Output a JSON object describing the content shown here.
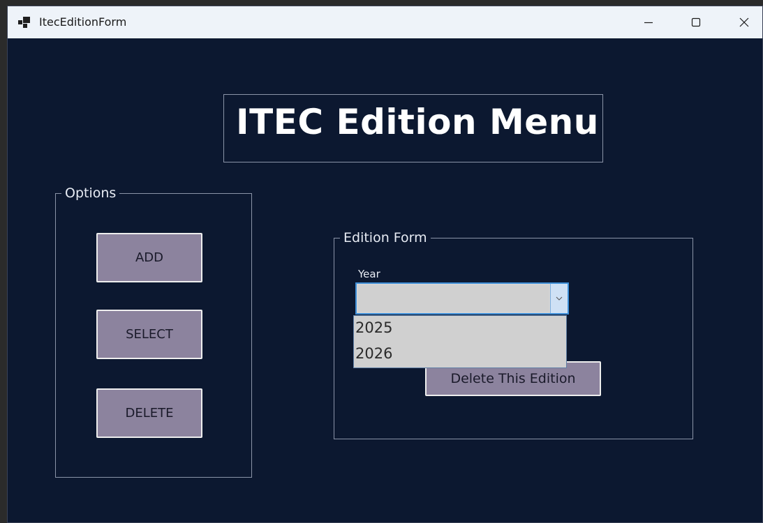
{
  "window": {
    "title": "ItecEditionForm"
  },
  "main": {
    "heading": "ITEC Edition Menu"
  },
  "options": {
    "legend": "Options",
    "add_label": "ADD",
    "select_label": "SELECT",
    "delete_label": "DELETE"
  },
  "edition_form": {
    "legend": "Edition Form",
    "year_label": "Year",
    "year_value": "",
    "year_options": [
      "2025",
      "2026"
    ],
    "delete_edition_label": "Delete This Edition"
  },
  "colors": {
    "background": "#0c1830",
    "button": "#8c839e",
    "titlebar": "#eef3f9",
    "combo_focus_border": "#3e8fd8"
  },
  "icons": {
    "app": "app-icon",
    "minimize": "minimize-icon",
    "maximize": "maximize-icon",
    "close": "close-icon",
    "dropdown": "chevron-down-icon"
  }
}
